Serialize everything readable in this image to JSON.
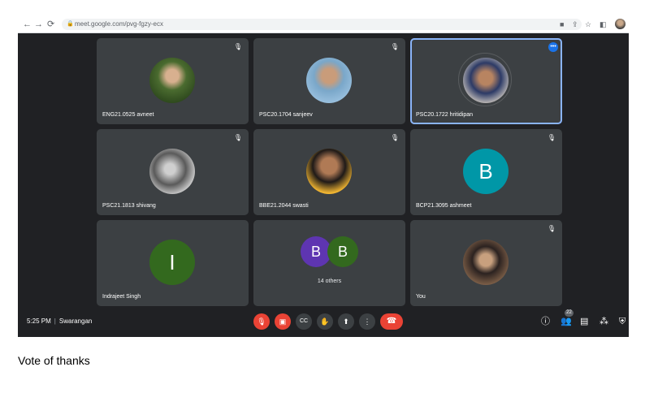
{
  "browser": {
    "back": "←",
    "forward": "→",
    "reload": "⟳",
    "url": "meet.google.com/pvg-fgzy-ecx"
  },
  "icons": {
    "mic_off": "🎙",
    "more": "•••"
  },
  "tiles": [
    {
      "name": "ENG21.0525 avneet"
    },
    {
      "name": "PSC20.1704 sanjeev"
    },
    {
      "name": "PSC20.1722 hritidipan"
    },
    {
      "name": "PSC21.1813 shivang"
    },
    {
      "name": "BBE21.2044 swasti"
    },
    {
      "name": "BCP21.3095 ashmeet",
      "initial": "B",
      "color": "#0097a7"
    },
    {
      "name": "Indrajeet Singh",
      "initial": "I",
      "color": "#33691e"
    },
    {
      "others": "14 others",
      "initials": [
        "B",
        "B"
      ],
      "colors": [
        "#5e35b1",
        "#33691e"
      ]
    },
    {
      "name": "You"
    }
  ],
  "bottom_bar": {
    "time": "5:25 PM",
    "meeting_name": "Swarangan",
    "people_count": "22"
  },
  "caption": "Vote of thanks"
}
